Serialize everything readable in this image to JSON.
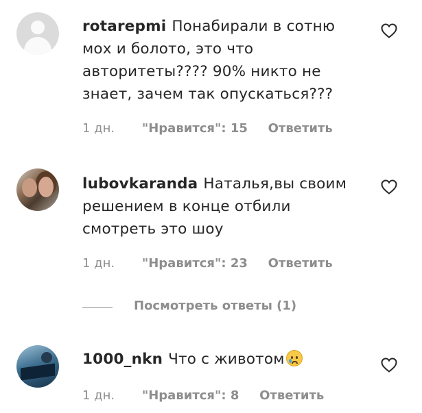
{
  "comments": [
    {
      "username": "rotarepmi",
      "text": "Понабирали в сотню мох и болото, это что авторитеты???? 90% никто не знает, зачем так опускаться???",
      "time": "1 дн.",
      "likes": "\"Нравится\": 15",
      "reply": "Ответить",
      "avatar": "default-avatar-icon"
    },
    {
      "username": "lubovkaranda",
      "text": "Наталья,вы своим решением в конце отбили смотреть это шоу",
      "time": "1 дн.",
      "likes": "\"Нравится\": 23",
      "reply": "Ответить",
      "avatar": "user-photo"
    },
    {
      "username": "1000_nkn",
      "text": "Что с животом",
      "emoji": "crying-face-emoji",
      "time": "1 дн.",
      "likes": "\"Нравится\": 8",
      "reply": "Ответить",
      "avatar": "user-photo"
    }
  ],
  "view_replies": "Посмотреть ответы (1)",
  "icons": {
    "like": "heart-outline-icon"
  },
  "colors": {
    "text": "#262626",
    "meta": "#8e8e8e",
    "background": "#ffffff"
  }
}
